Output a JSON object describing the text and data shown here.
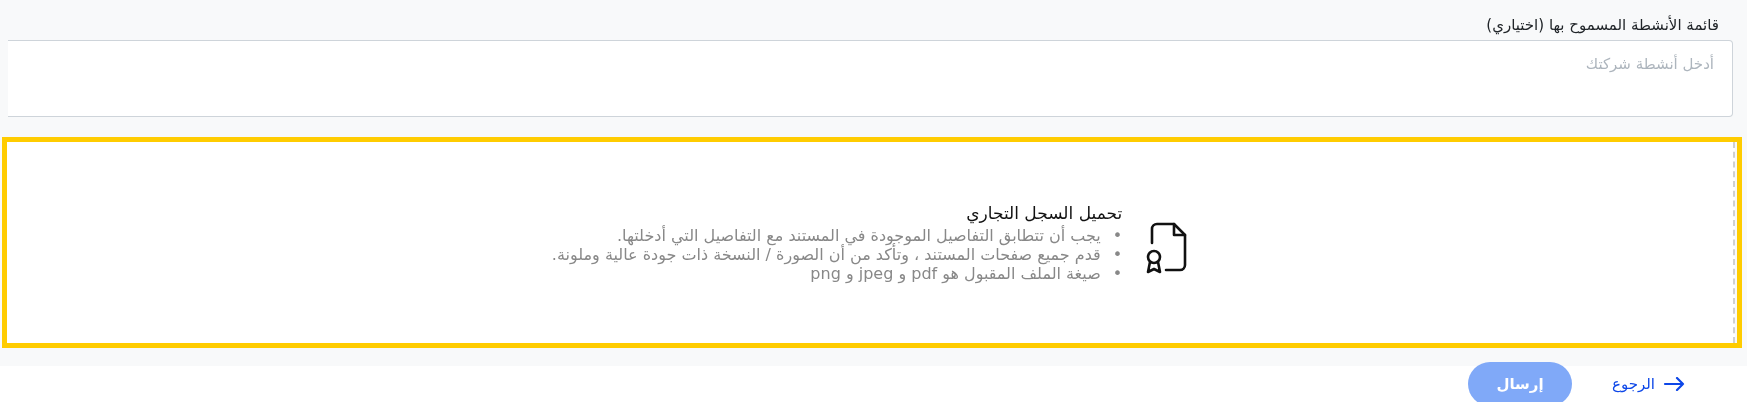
{
  "activities_field": {
    "label": "قائمة الأنشطة المسموح بها (اختياري)",
    "placeholder": "أدخل أنشطة شركتك"
  },
  "upload": {
    "title": "تحميل السجل التجاري",
    "highlighted": true,
    "bullet": "•",
    "instructions": [
      "يجب أن تتطابق التفاصيل الموجودة في المستند مع التفاصيل التي أدخلتها.",
      "قدم جميع صفحات المستند ، وتأكد من أن الصورة / النسخة ذات جودة عالية وملونة.",
      "صيغة الملف المقبول هو pdf و jpeg و png"
    ]
  },
  "actions": {
    "back": "الرجوع",
    "submit": {
      "label": "إرسال",
      "disabled": true
    }
  }
}
